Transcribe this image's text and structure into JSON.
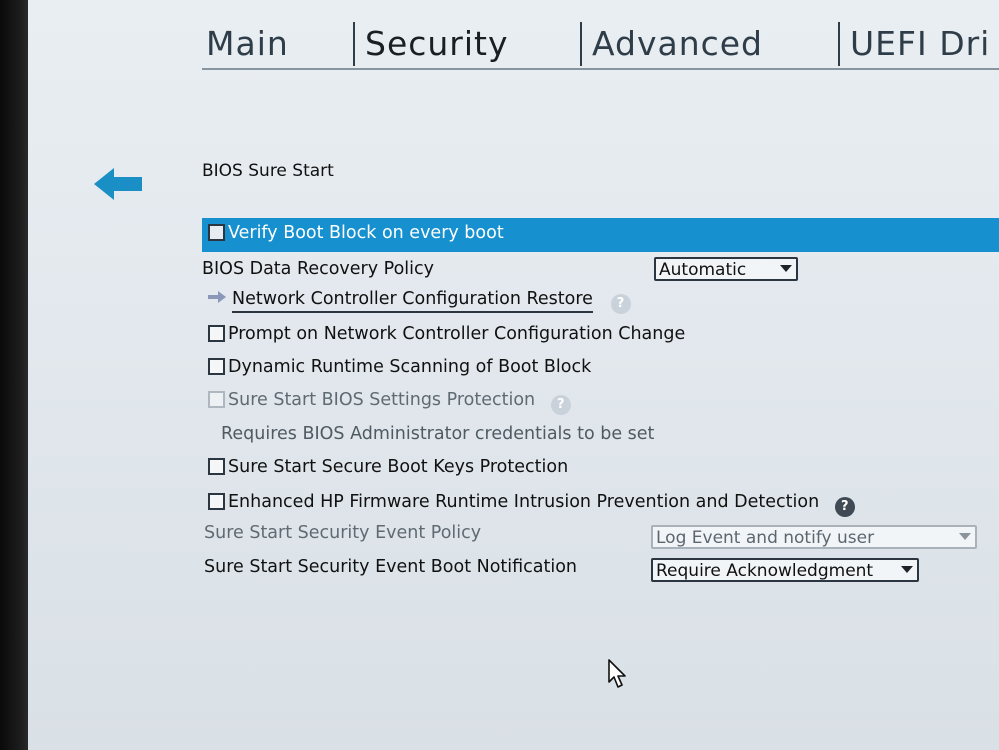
{
  "tabs": [
    {
      "label": "Main",
      "active": false
    },
    {
      "label": "Security",
      "active": true
    },
    {
      "label": "Advanced",
      "active": false
    },
    {
      "label": "UEFI Dri",
      "active": false
    }
  ],
  "nav": {
    "back_icon": "arrow-left-icon"
  },
  "section": {
    "title": "BIOS Sure Start"
  },
  "settings": {
    "verify_boot_block": {
      "label": "Verify Boot Block on every boot",
      "checked": false,
      "selected": true
    },
    "data_recovery_policy": {
      "label": "BIOS Data Recovery Policy",
      "value": "Automatic"
    },
    "network_restore": {
      "label": "Network Controller Configuration Restore"
    },
    "prompt_network_change": {
      "label": "Prompt on Network Controller Configuration Change",
      "checked": false
    },
    "dynamic_scanning": {
      "label": "Dynamic Runtime Scanning of Boot Block",
      "checked": false
    },
    "settings_protection": {
      "label": "Sure Start BIOS Settings Protection",
      "checked": false,
      "disabled": true
    },
    "admin_note": "Requires BIOS Administrator credentials to be set",
    "secure_boot_keys": {
      "label": "Sure Start Secure Boot Keys Protection",
      "checked": false
    },
    "intrusion_prevention": {
      "label": "Enhanced HP Firmware Runtime Intrusion Prevention and Detection",
      "checked": false
    },
    "event_policy": {
      "label": "Sure Start Security Event Policy",
      "value": "Log Event and notify user",
      "disabled": true
    },
    "boot_notification": {
      "label": "Sure Start Security Event Boot Notification",
      "value": "Require Acknowledgment"
    }
  },
  "help_glyph": "?",
  "colors": {
    "accent": "#1690cf",
    "text": "#111111",
    "disabled": "#606a73"
  }
}
